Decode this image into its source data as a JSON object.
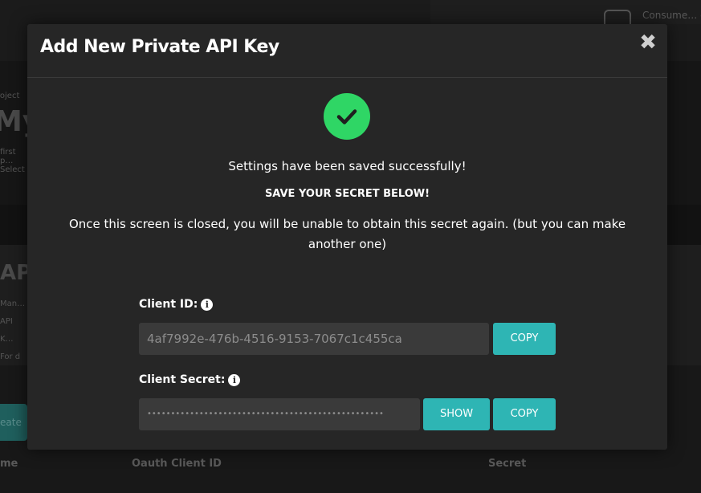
{
  "background": {
    "consumer_text": "Consume… ection",
    "project_label": "roject",
    "project_title": "My",
    "project_sub": "first p… Select",
    "api_title": "AP",
    "api_sub": "Man… API K… For d",
    "create_button": "eate",
    "table_headers": [
      "me",
      "Oauth Client ID",
      "Secret"
    ]
  },
  "modal": {
    "title": "Add New Private API Key",
    "close_symbol": "✖",
    "success_message": "Settings have been saved successfully!",
    "warning_message": "SAVE YOUR SECRET BELOW!",
    "info_message": "Once this screen is closed, you will be unable to obtain this secret again. (but you can make another one)",
    "client_id": {
      "label": "Client ID:",
      "value": "4af7992e-476b-4516-9153-7067c1c455ca",
      "copy_label": "COPY"
    },
    "client_secret": {
      "label": "Client Secret:",
      "masked_value": "••••••••••••••••••••••••••••••••••••••••••••••••••",
      "show_label": "SHOW",
      "copy_label": "COPY"
    },
    "colors": {
      "accent": "#2eb5b4",
      "success": "#2fd665",
      "modal_bg": "#262626"
    }
  }
}
